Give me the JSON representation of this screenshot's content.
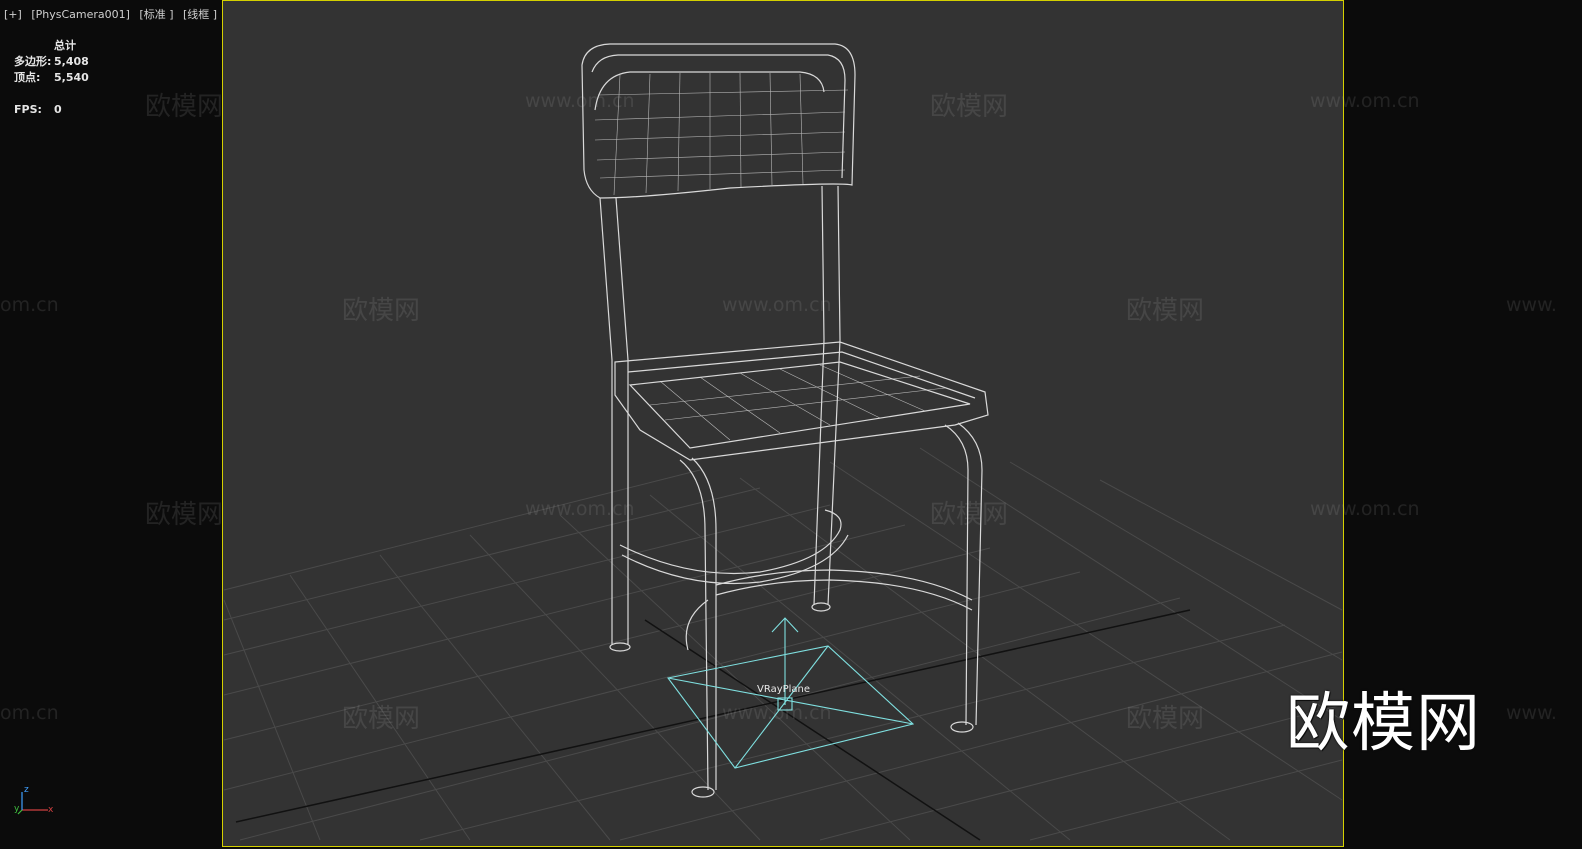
{
  "viewport": {
    "labels": [
      "[+]",
      "[PhysCamera001]",
      "[标准 ]",
      "[线框 ]"
    ]
  },
  "stats": {
    "header": "总计",
    "polygons_label": "多边形:",
    "polygons_value": "5,408",
    "vertices_label": "顶点:",
    "vertices_value": "5,540",
    "fps_label": "FPS:",
    "fps_value": "0"
  },
  "scene": {
    "object_label": "VRayPlane",
    "frame_color": "#d4d000",
    "wire_color": "#d9d9d9",
    "helper_color": "#7fe0e0",
    "grid_color": "#4a4a4a"
  },
  "watermarks": {
    "brand": "欧模网",
    "url": "www.om.cn",
    "url_short": "om.cn",
    "url_prefix": "www."
  },
  "logo": {
    "text": "欧模网"
  },
  "axis": {
    "x": "x",
    "y": "y",
    "z": "z"
  }
}
